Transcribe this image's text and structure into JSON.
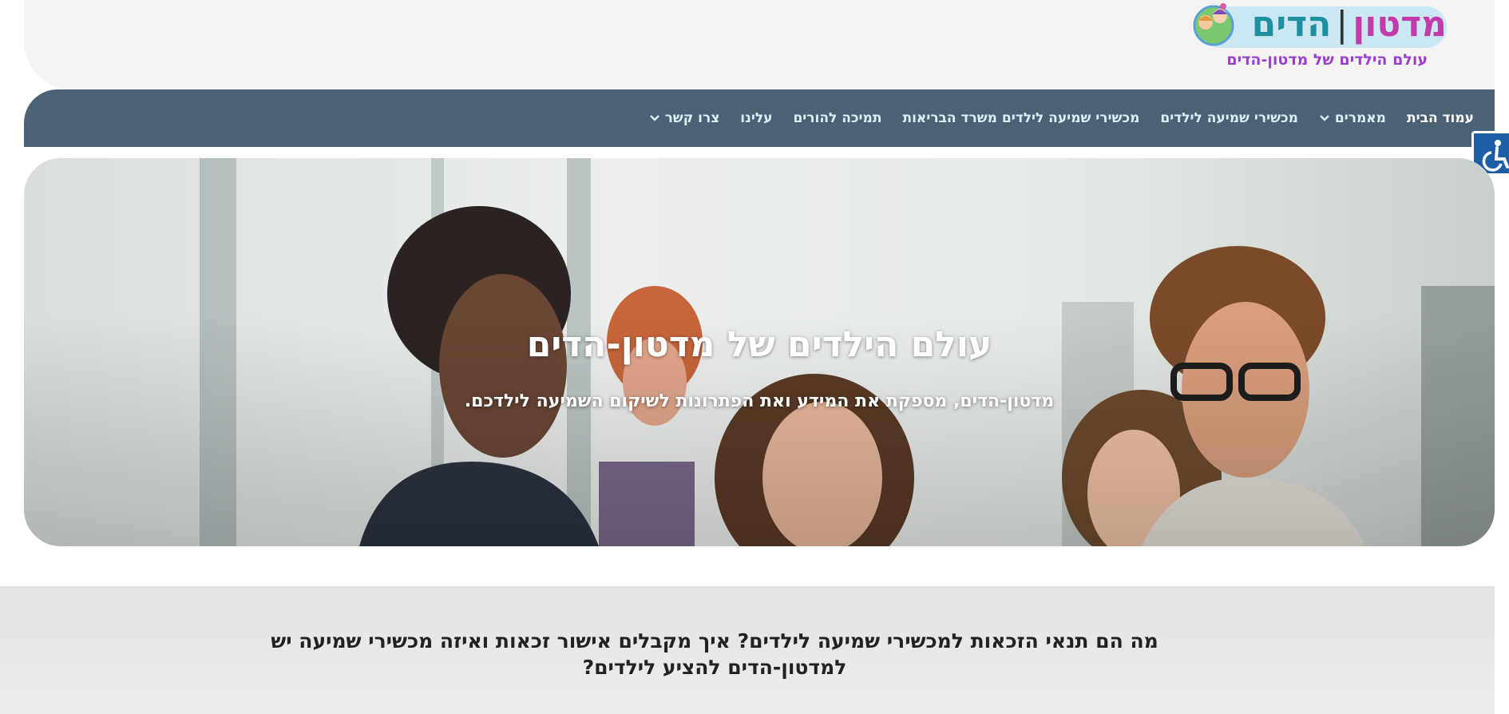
{
  "header": {
    "logo": {
      "part1": "מדטון",
      "separator": "|",
      "part2": "הדים",
      "tagline": "עולם הילדים של מדטון-הדים",
      "icon": "kids-cartoon-icon"
    }
  },
  "nav": {
    "items": [
      {
        "label": "עמוד הבית",
        "active": true,
        "dropdown": false
      },
      {
        "label": "מאמרים",
        "active": false,
        "dropdown": true
      },
      {
        "label": "מכשירי שמיעה לילדים",
        "active": false,
        "dropdown": false
      },
      {
        "label": "מכשירי שמיעה לילדים משרד הבריאות",
        "active": false,
        "dropdown": false
      },
      {
        "label": "תמיכה להורים",
        "active": false,
        "dropdown": false
      },
      {
        "label": "עלינו",
        "active": false,
        "dropdown": false
      },
      {
        "label": "צרו קשר",
        "active": false,
        "dropdown": true
      }
    ]
  },
  "accessibility": {
    "icon": "wheelchair-accessibility-icon",
    "color": "#1c5fa8"
  },
  "hero": {
    "title": "עולם הילדים של מדטון-הדים",
    "subtitle": "מדטון-הדים, מספקת את המידע ואת הפתרונות לשיקום השמיעה לילדכם."
  },
  "section": {
    "heading": "מה הם תנאי הזכאות למכשירי שמיעה לילדים? איך מקבלים אישור זכאות ואיזה מכשירי שמיעה יש למדטון-הדים להציע לילדים?"
  },
  "colors": {
    "nav_bg": "#4a6274",
    "nav_text": "#d6f2f6",
    "logo_pink": "#c23ca8",
    "logo_teal": "#1e8f9f",
    "tagline_purple": "#9a3fd0"
  }
}
